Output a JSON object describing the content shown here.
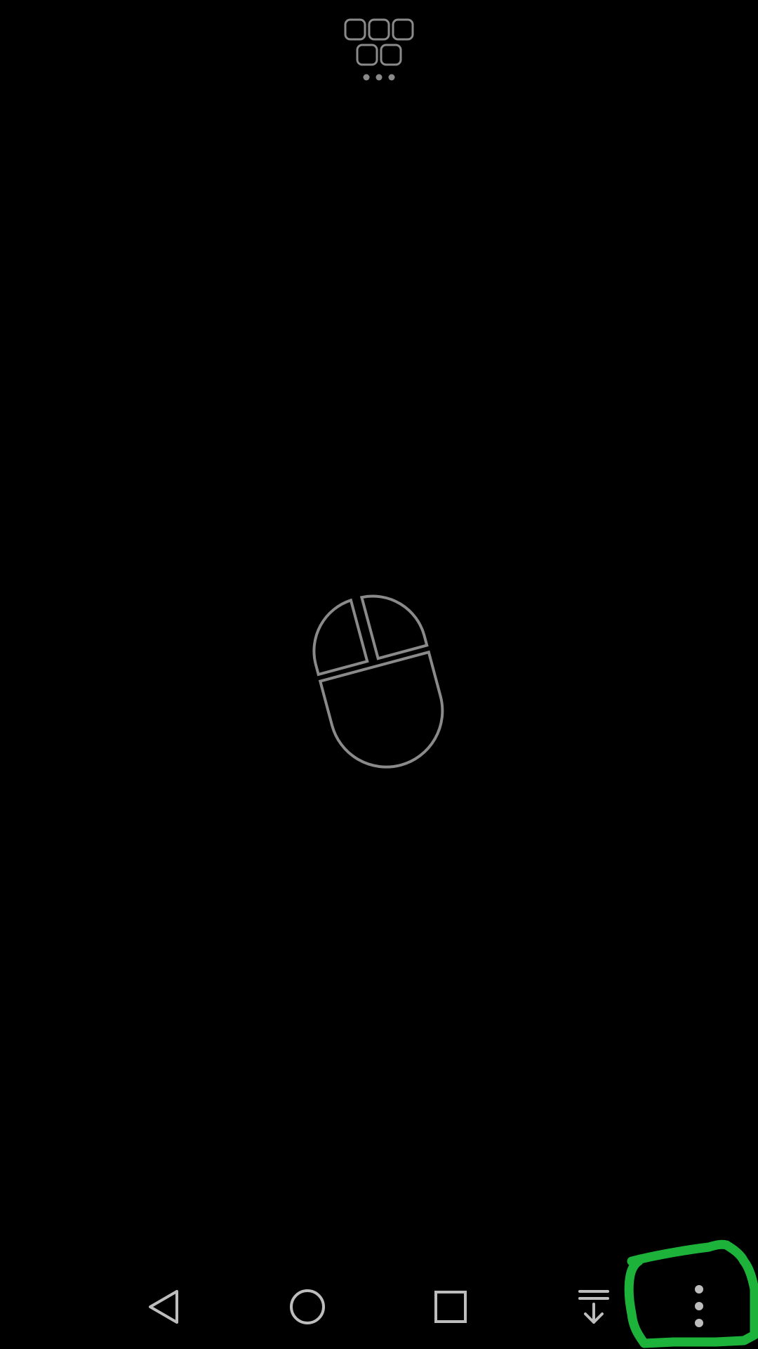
{
  "colors": {
    "background": "#000000",
    "icon": "#8a8a8a",
    "nav_icon": "#bdbdbd",
    "annotation": "#1db33a"
  },
  "icons": {
    "keyboard_toggle": "keyboard-icon",
    "center": "mouse-icon",
    "nav_back": "back-triangle-icon",
    "nav_home": "home-circle-icon",
    "nav_recents": "recents-square-icon",
    "nav_hide": "hide-navbar-icon",
    "nav_more": "more-vertical-icon"
  }
}
